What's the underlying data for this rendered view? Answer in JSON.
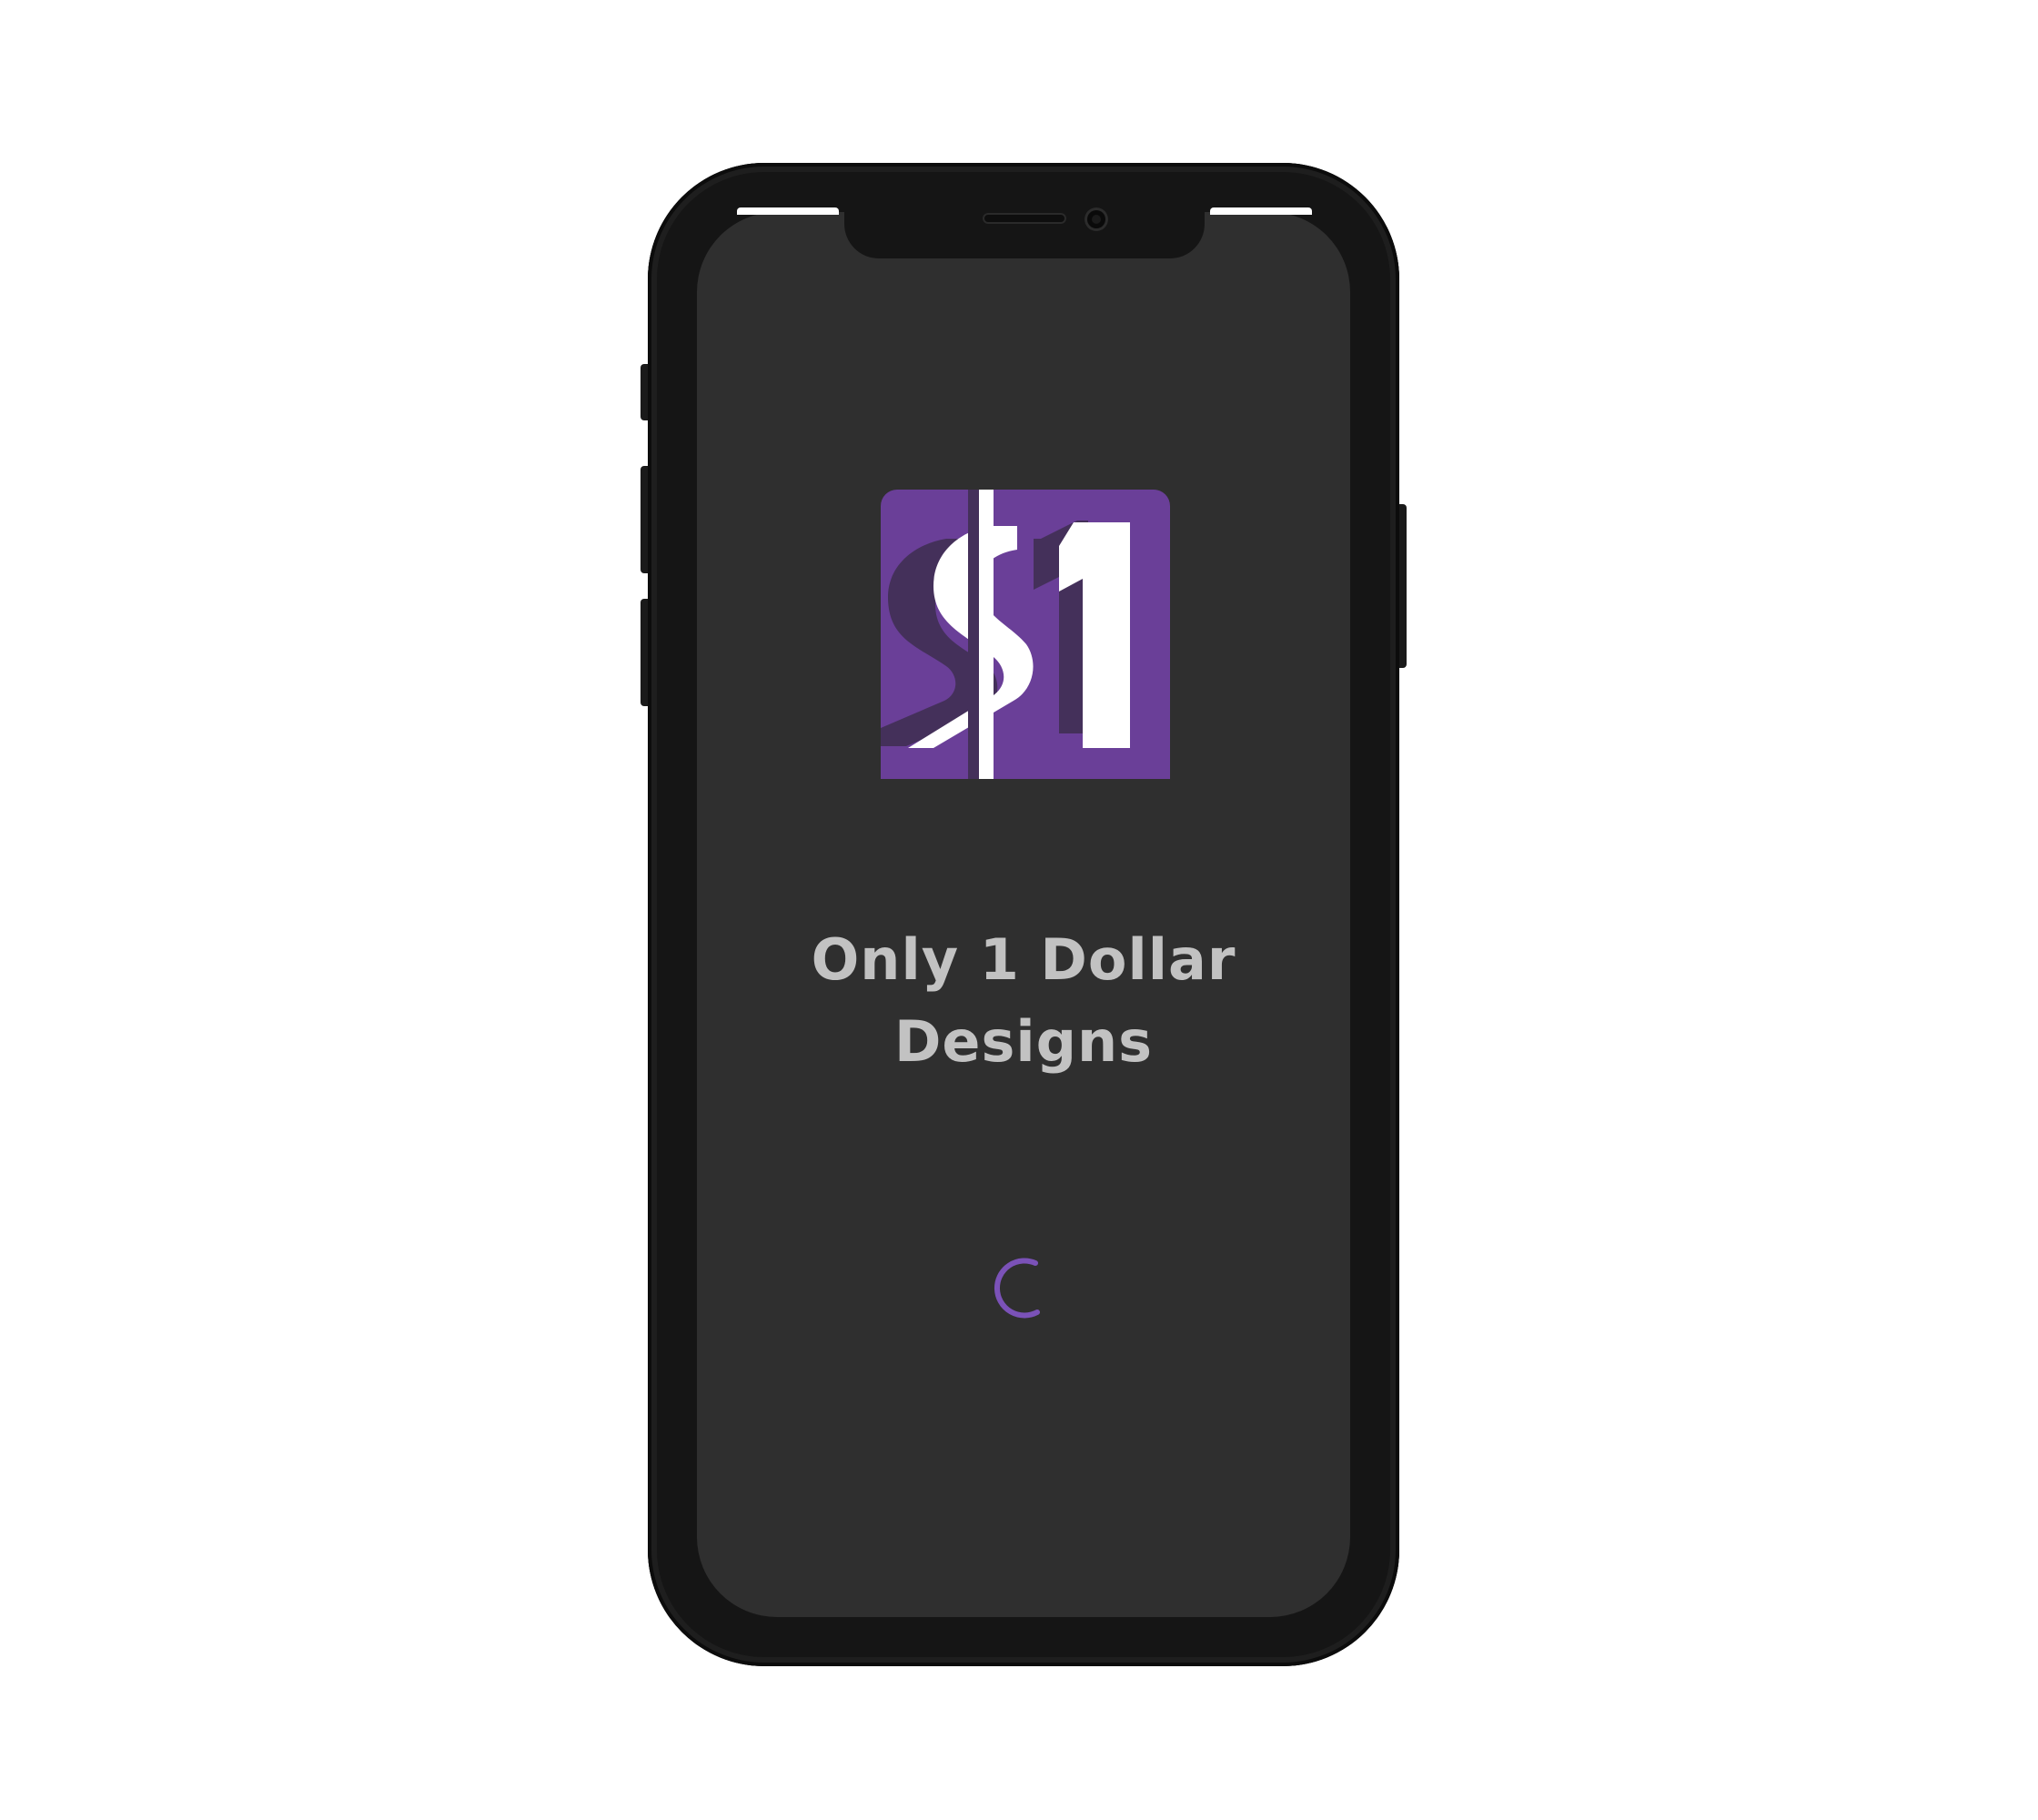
{
  "app": {
    "title_line1": "Only 1 Dollar",
    "title_line2": "Designs",
    "logo_icon": "dollar-one-logo-icon",
    "accent_color": "#6a3f98",
    "loading_indicator": "loading-spinner-icon"
  },
  "device": {
    "screen_color": "#2f2f2f",
    "frame_color": "#151515"
  }
}
